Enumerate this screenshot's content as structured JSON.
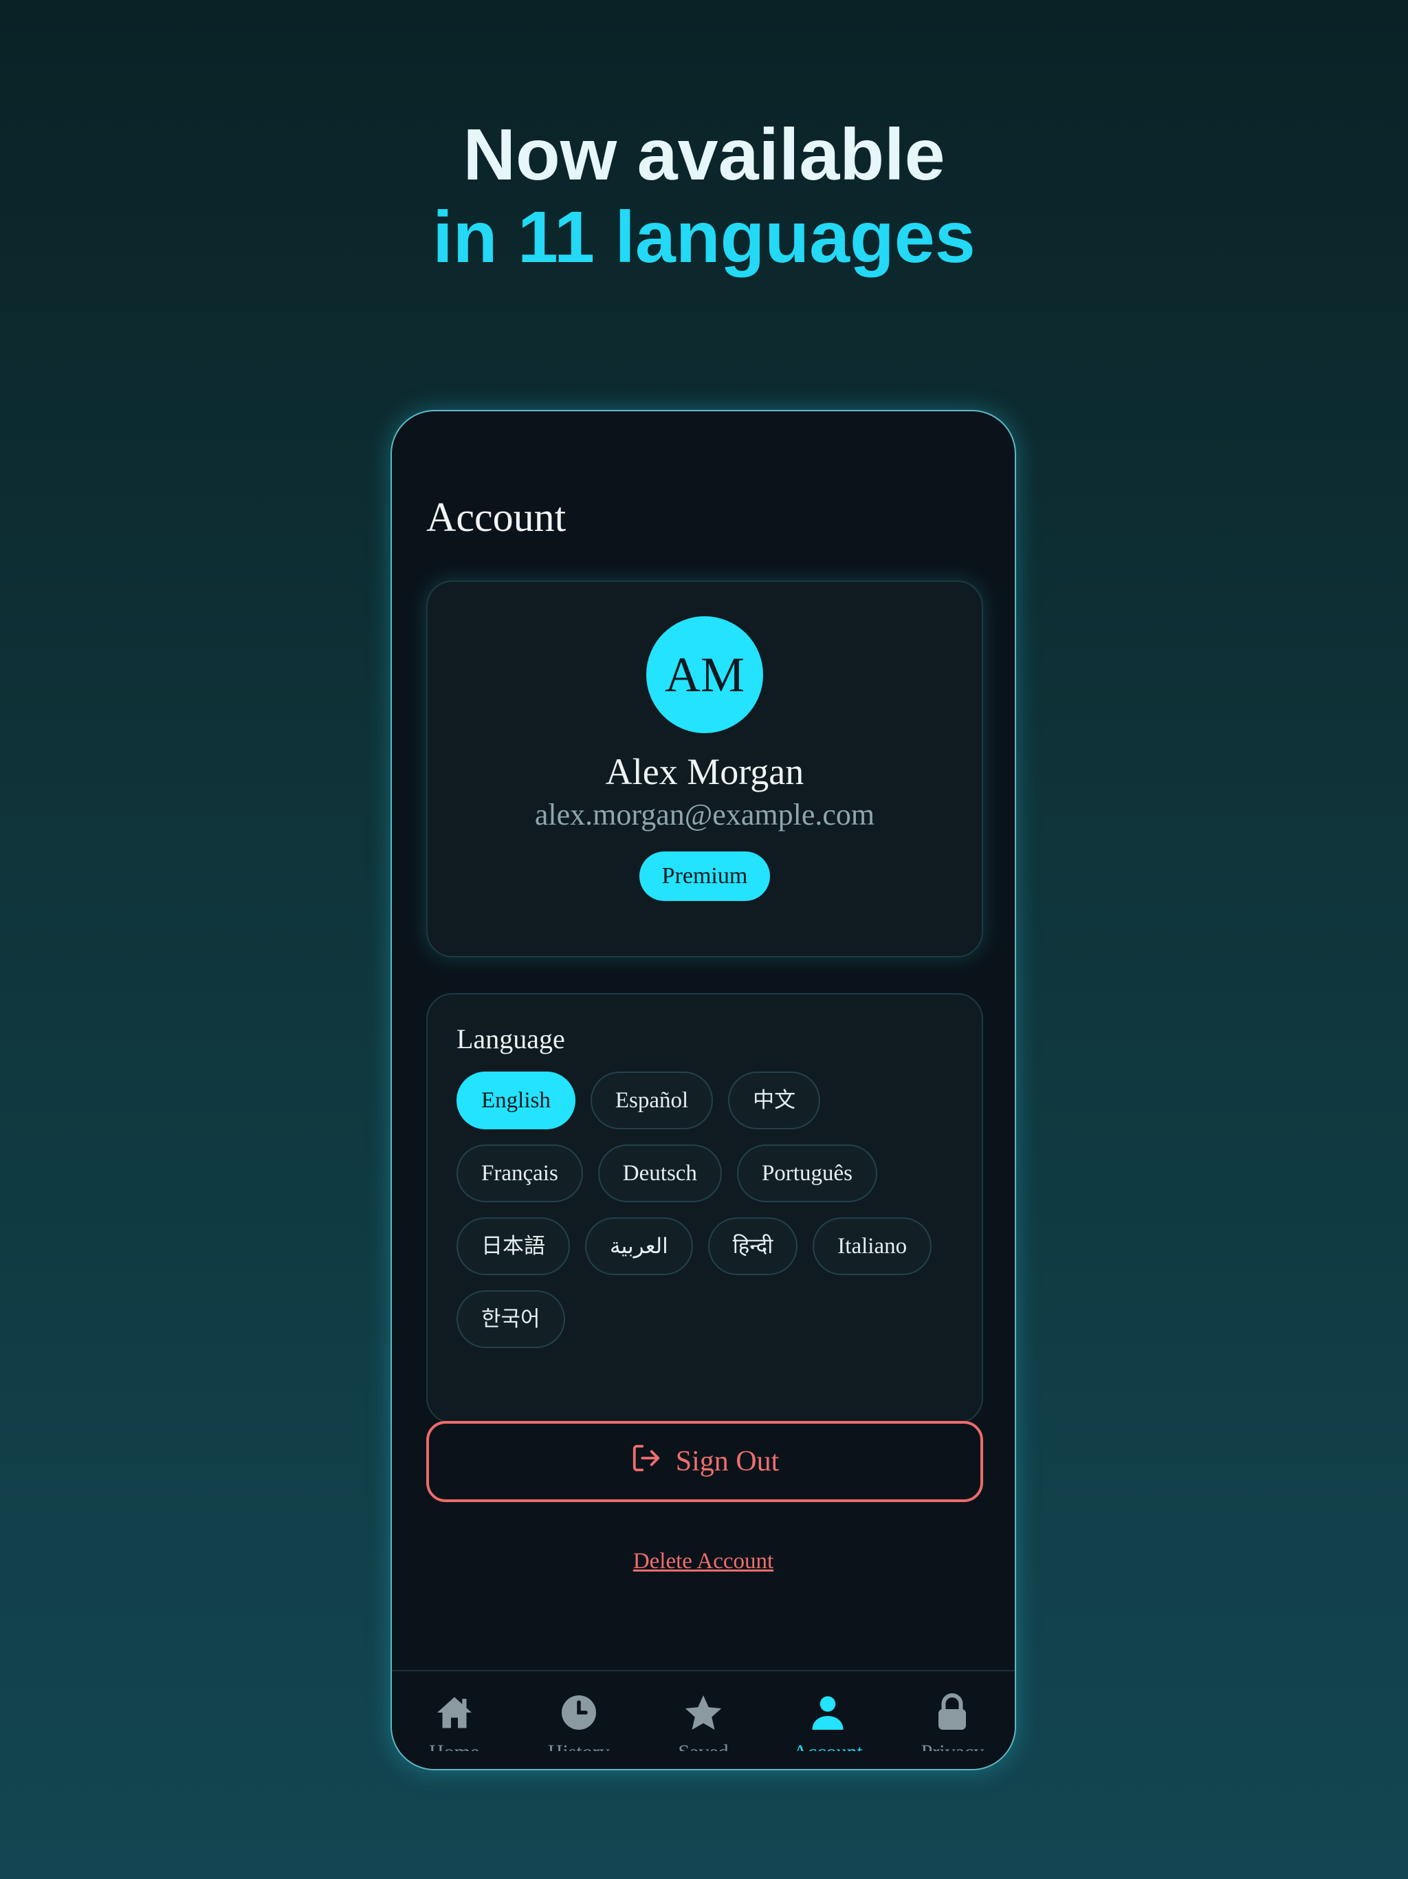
{
  "headline": {
    "line1": "Now available",
    "line2": "in 11 languages"
  },
  "screen": {
    "title": "Account",
    "profile": {
      "initials": "AM",
      "name": "Alex Morgan",
      "email": "alex.morgan@example.com",
      "badge": "Premium"
    },
    "language": {
      "title": "Language",
      "selected": "English",
      "options": [
        "English",
        "Español",
        "中文",
        "Français",
        "Deutsch",
        "Português",
        "日本語",
        "العربية",
        "हिन्दी",
        "Italiano",
        "한국어"
      ]
    },
    "sign_out_label": "Sign Out",
    "delete_account_label": "Delete Account",
    "tabs": [
      {
        "label": "Home",
        "icon": "home-icon"
      },
      {
        "label": "History",
        "icon": "clock-icon"
      },
      {
        "label": "Saved",
        "icon": "star-icon"
      },
      {
        "label": "Account",
        "icon": "person-icon",
        "active": true
      },
      {
        "label": "Privacy",
        "icon": "lock-icon"
      }
    ]
  },
  "colors": {
    "accent": "#23e3ff",
    "danger": "#ee6b6b",
    "surface": "#0b131a",
    "inactive_icon": "#7a8d95"
  }
}
